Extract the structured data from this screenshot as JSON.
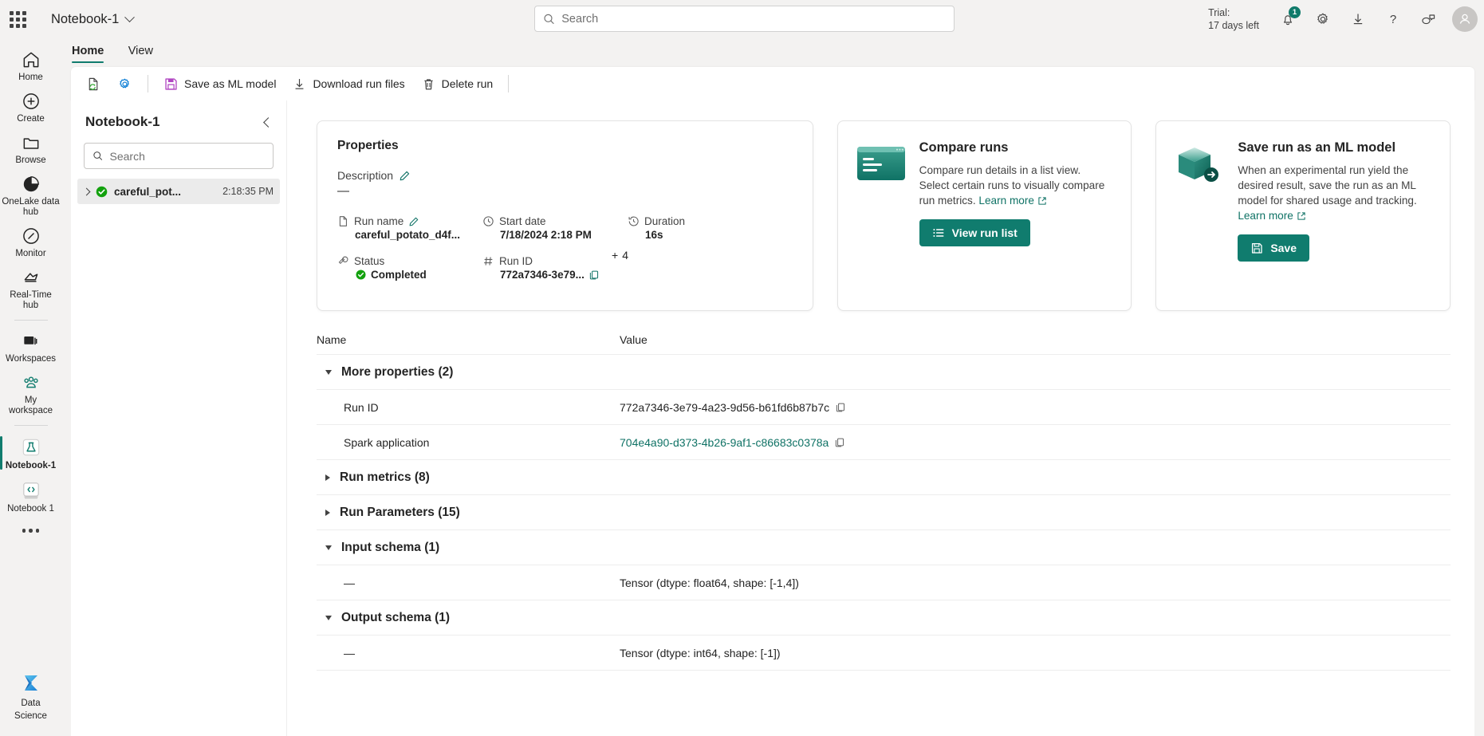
{
  "topbar": {
    "app_title": "Notebook-1",
    "search_placeholder": "Search",
    "trial_line1": "Trial:",
    "trial_line2": "17 days left",
    "notification_count": "1",
    "icons": {
      "waffle": "app-launcher-icon",
      "search": "search-icon",
      "bell": "notifications-icon",
      "gear": "settings-icon",
      "download": "downloads-icon",
      "help": "help-icon",
      "feedback": "feedback-icon",
      "avatar": "account-avatar"
    }
  },
  "rail": {
    "items": [
      {
        "label": "Home",
        "icon": "home-icon",
        "selected": false
      },
      {
        "label": "Create",
        "icon": "plus-circle-icon",
        "selected": false
      },
      {
        "label": "Browse",
        "icon": "folder-icon",
        "selected": false
      },
      {
        "label": "OneLake data hub",
        "icon": "onelake-icon",
        "selected": false
      },
      {
        "label": "Monitor",
        "icon": "compass-icon",
        "selected": false
      },
      {
        "label": "Real-Time hub",
        "icon": "realtime-hub-icon",
        "selected": false
      },
      {
        "label": "Workspaces",
        "icon": "workspaces-icon",
        "selected": false
      },
      {
        "label": "My workspace",
        "icon": "people-icon",
        "selected": false
      },
      {
        "label": "Notebook-1",
        "icon": "experiment-flask-icon",
        "selected": true
      },
      {
        "label": "Notebook 1",
        "icon": "notebook-code-icon",
        "selected": false
      }
    ],
    "more_label": "more-options-dots",
    "bottom": {
      "label_line1": "Data",
      "label_line2": "Science",
      "icon": "fabric-data-science-icon"
    }
  },
  "ribbon": {
    "tabs": [
      {
        "label": "Home",
        "active": true
      },
      {
        "label": "View",
        "active": false
      }
    ]
  },
  "toolbar": {
    "refresh_icon": "refresh-document-icon",
    "settings_icon": "run-settings-gear-icon",
    "buttons": [
      {
        "label": "Save as ML model",
        "icon": "save-disk-icon"
      },
      {
        "label": "Download run files",
        "icon": "download-arrow-icon"
      },
      {
        "label": "Delete run",
        "icon": "trash-icon"
      }
    ]
  },
  "pane": {
    "title": "Notebook-1",
    "collapse_icon": "collapse-chevron-left-icon",
    "search_placeholder": "Search",
    "runs": [
      {
        "name": "careful_pot...",
        "time": "2:18:35 PM",
        "status_icon": "status-success-icon"
      }
    ]
  },
  "properties_card": {
    "heading": "Properties",
    "description_label": "Description",
    "description_value": "—",
    "edit_icon": "pencil-edit-icon",
    "fields": [
      {
        "key": "Run name",
        "value": "careful_potato_d4f...",
        "icon": "document-icon",
        "editable": true
      },
      {
        "key": "Start date",
        "value": "7/18/2024 2:18 PM",
        "icon": "clock-icon",
        "editable": false
      },
      {
        "key": "Duration",
        "value": "16s",
        "icon": "duration-history-icon",
        "editable": false
      },
      {
        "key": "Status",
        "value": "Completed",
        "icon": "status-tag-icon",
        "editable": false
      },
      {
        "key": "Run ID",
        "value": "772a7346-3e79...",
        "icon": "hash-icon",
        "editable": false,
        "copyable": true
      }
    ],
    "more_count": "4",
    "more_prefix": "+"
  },
  "compare_card": {
    "title": "Compare runs",
    "body": "Compare run details in a list view. Select certain runs to visually compare run metrics.",
    "learn_more": "Learn more",
    "button_label": "View run list",
    "button_icon": "list-view-icon",
    "image_icon": "compare-runs-illustration"
  },
  "save_card": {
    "title": "Save run as an ML model",
    "body": "When an experimental run yield the desired result, save the run as an ML model for shared usage and tracking.",
    "learn_more": "Learn more",
    "button_label": "Save",
    "button_icon": "save-disk-icon",
    "image_icon": "ml-model-cube-illustration"
  },
  "table": {
    "columns": [
      "Name",
      "Value"
    ],
    "sections": [
      {
        "label": "More properties (2)",
        "expanded": true,
        "rows": [
          {
            "name": "Run ID",
            "value": "772a7346-3e79-4a23-9d56-b61fd6b87b7c",
            "copyable": true,
            "link": false
          },
          {
            "name": "Spark application",
            "value": "704e4a90-d373-4b26-9af1-c86683c0378a",
            "copyable": true,
            "link": true
          }
        ]
      },
      {
        "label": "Run metrics (8)",
        "expanded": false,
        "rows": []
      },
      {
        "label": "Run Parameters (15)",
        "expanded": false,
        "rows": []
      },
      {
        "label": "Input schema (1)",
        "expanded": true,
        "rows": [
          {
            "name": "—",
            "value": "Tensor (dtype: float64, shape: [-1,4])",
            "copyable": false,
            "link": false
          }
        ]
      },
      {
        "label": "Output schema (1)",
        "expanded": true,
        "rows": [
          {
            "name": "—",
            "value": "Tensor (dtype: int64, shape: [-1])",
            "copyable": false,
            "link": false
          }
        ]
      }
    ]
  },
  "colors": {
    "accent_green": "#107c6e",
    "link_green": "#0f7265",
    "success_green": "#13a10e",
    "app_bg": "#f3f2f1",
    "surface": "#ffffff",
    "magenta": "#b146c2",
    "blue": "#0078d4"
  }
}
